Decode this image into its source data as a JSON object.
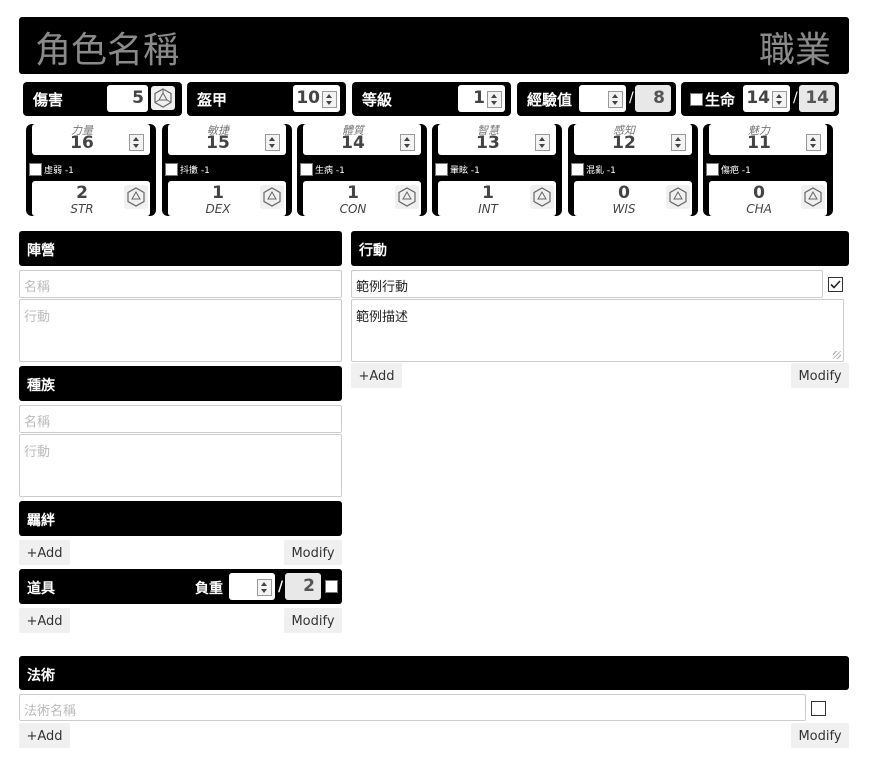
{
  "header": {
    "character_name": "角色名稱",
    "class_name": "職業"
  },
  "stats": {
    "damage": {
      "label": "傷害",
      "value": "5"
    },
    "armor": {
      "label": "盔甲",
      "value": "10"
    },
    "level": {
      "label": "等級",
      "value": "1"
    },
    "xp": {
      "label": "經驗值",
      "value": "",
      "max": "8"
    },
    "hp": {
      "label": "生命",
      "value": "14",
      "max": "14"
    },
    "slash": "/"
  },
  "abilities": [
    {
      "name": "力量",
      "score": "16",
      "debuff": "虛弱 -1",
      "modifier": "2",
      "abbr": "STR"
    },
    {
      "name": "敏捷",
      "score": "15",
      "debuff": "抖擻 -1",
      "modifier": "1",
      "abbr": "DEX"
    },
    {
      "name": "體質",
      "score": "14",
      "debuff": "生病 -1",
      "modifier": "1",
      "abbr": "CON"
    },
    {
      "name": "智慧",
      "score": "13",
      "debuff": "暈眩 -1",
      "modifier": "1",
      "abbr": "INT"
    },
    {
      "name": "感知",
      "score": "12",
      "debuff": "混亂 -1",
      "modifier": "0",
      "abbr": "WIS"
    },
    {
      "name": "魅力",
      "score": "11",
      "debuff": "傷疤 -1",
      "modifier": "0",
      "abbr": "CHA"
    }
  ],
  "alignment": {
    "title": "陣營",
    "name_placeholder": "名稱",
    "action_placeholder": "行動"
  },
  "race": {
    "title": "種族",
    "name_placeholder": "名稱",
    "action_placeholder": "行動"
  },
  "bonds": {
    "title": "羈絆",
    "add_label": "+Add",
    "modify_label": "Modify"
  },
  "gear": {
    "title": "道具",
    "load_label": "負重",
    "load_value": "",
    "load_max": "2",
    "add_label": "+Add",
    "modify_label": "Modify"
  },
  "moves": {
    "title": "行動",
    "move_name": "範例行動",
    "move_desc": "範例描述",
    "add_label": "+Add",
    "modify_label": "Modify"
  },
  "spells": {
    "title": "法術",
    "name_placeholder": "法術名稱",
    "add_label": "+Add",
    "modify_label": "Modify"
  }
}
